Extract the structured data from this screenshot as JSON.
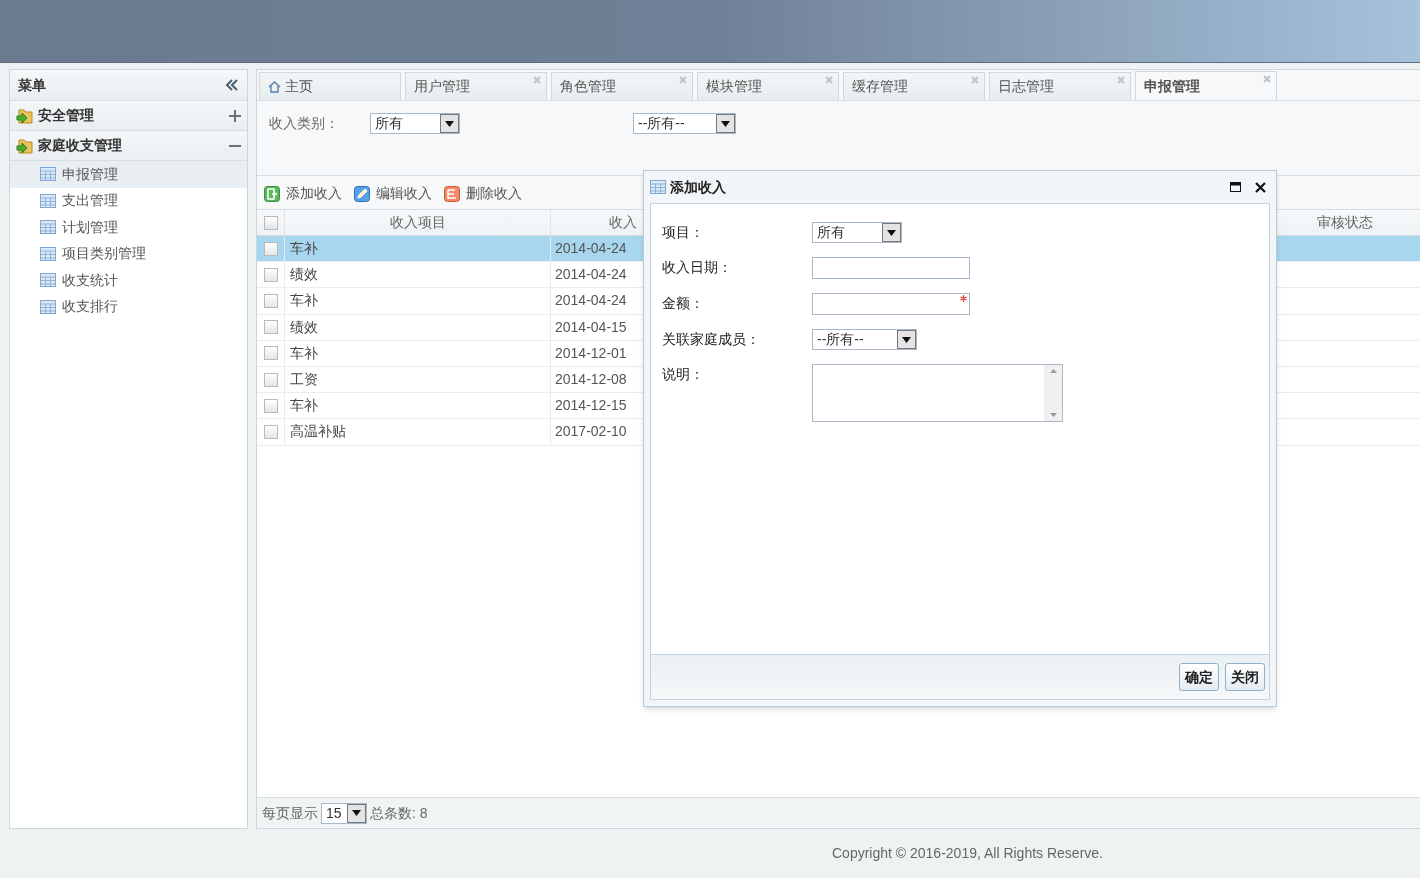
{
  "sidebar": {
    "title": "菜单",
    "groups": [
      {
        "label": "安全管理",
        "expanded": false
      },
      {
        "label": "家庭收支管理",
        "expanded": true,
        "children": [
          {
            "label": "申报管理",
            "selected": true
          },
          {
            "label": "支出管理",
            "selected": false
          },
          {
            "label": "计划管理",
            "selected": false
          },
          {
            "label": "项目类别管理",
            "selected": false
          },
          {
            "label": "收支统计",
            "selected": false
          },
          {
            "label": "收支排行",
            "selected": false
          }
        ]
      }
    ]
  },
  "tabs": [
    {
      "label": "主页",
      "kind": "home",
      "selected": false
    },
    {
      "label": "用户管理",
      "kind": "page",
      "selected": false
    },
    {
      "label": "角色管理",
      "kind": "page",
      "selected": false
    },
    {
      "label": "模块管理",
      "kind": "page",
      "selected": false
    },
    {
      "label": "缓存管理",
      "kind": "page",
      "selected": false
    },
    {
      "label": "日志管理",
      "kind": "page",
      "selected": false
    },
    {
      "label": "申报管理",
      "kind": "page",
      "selected": true
    }
  ],
  "filters": [
    {
      "label": "收入类别：",
      "value": "所有"
    },
    {
      "value": "--所有--"
    }
  ],
  "toolbar": [
    {
      "label": "添加收入",
      "kind": "add"
    },
    {
      "label": "编辑收入",
      "kind": "edit"
    },
    {
      "label": "删除收入",
      "kind": "delete"
    }
  ],
  "table": {
    "header_checked": false,
    "columns": [
      "收入项目",
      "收入",
      "审核状态"
    ],
    "rows": [
      {
        "item": "车补",
        "date": "2014-04-24",
        "selected": true,
        "checked": false
      },
      {
        "item": "绩效",
        "date": "2014-04-24",
        "selected": false,
        "checked": false
      },
      {
        "item": "车补",
        "date": "2014-04-24",
        "selected": false,
        "checked": false
      },
      {
        "item": "绩效",
        "date": "2014-04-15",
        "selected": false,
        "checked": false
      },
      {
        "item": "车补",
        "date": "2014-12-01",
        "selected": false,
        "checked": false
      },
      {
        "item": "工资",
        "date": "2014-12-08",
        "selected": false,
        "checked": false
      },
      {
        "item": "车补",
        "date": "2014-12-15",
        "selected": false,
        "checked": false
      },
      {
        "item": "高温补贴",
        "date": "2017-02-10",
        "selected": false,
        "checked": false
      }
    ]
  },
  "pager": {
    "label": "每页显示",
    "page_size": "15",
    "total": "总条数: 8"
  },
  "dialog": {
    "title": "添加收入",
    "fields": [
      {
        "label": "项目：",
        "kind": "select",
        "value": "所有"
      },
      {
        "label": "收入日期：",
        "kind": "text"
      },
      {
        "label": "金额：",
        "kind": "text",
        "required": true
      },
      {
        "label": "关联家庭成员：",
        "kind": "select",
        "value": "--所有--"
      },
      {
        "label": "说明：",
        "kind": "textarea"
      }
    ],
    "buttons": [
      "确定",
      "关闭"
    ]
  },
  "footer": "Copyright © 2016-2019, All Rights Reserve."
}
